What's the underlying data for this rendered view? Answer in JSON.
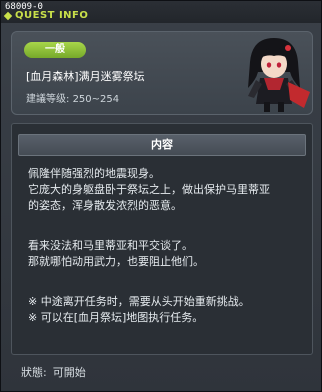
{
  "title_bar": {
    "quest_id": "68009-0",
    "title": "QUEST INFO"
  },
  "header": {
    "badge": "一般",
    "quest_name": "[血月森林]满月迷雾祭坛",
    "level_label": "建議等级:",
    "level_range": "250~254"
  },
  "content": {
    "heading": "内容",
    "lines": [
      "佩隆伴随强烈的地震现身。",
      "它庞大的身躯盘卧于祭坛之上，做出保护马里蒂亚",
      "的姿态，浑身散发浓烈的恶意。",
      "看来没法和马里蒂亚和平交谈了。",
      "那就哪怕动用武力，也要阻止他们。",
      "※ 中途离开任务时，需要从头开始重新挑战。",
      "※ 可以在[血月祭坛]地图执行任务。"
    ]
  },
  "status": {
    "label": "狀態:",
    "value": "可開始"
  },
  "colors": {
    "accent": "#c9e04a",
    "badge_green": "#8cc23a",
    "panel": "#3c434b"
  }
}
